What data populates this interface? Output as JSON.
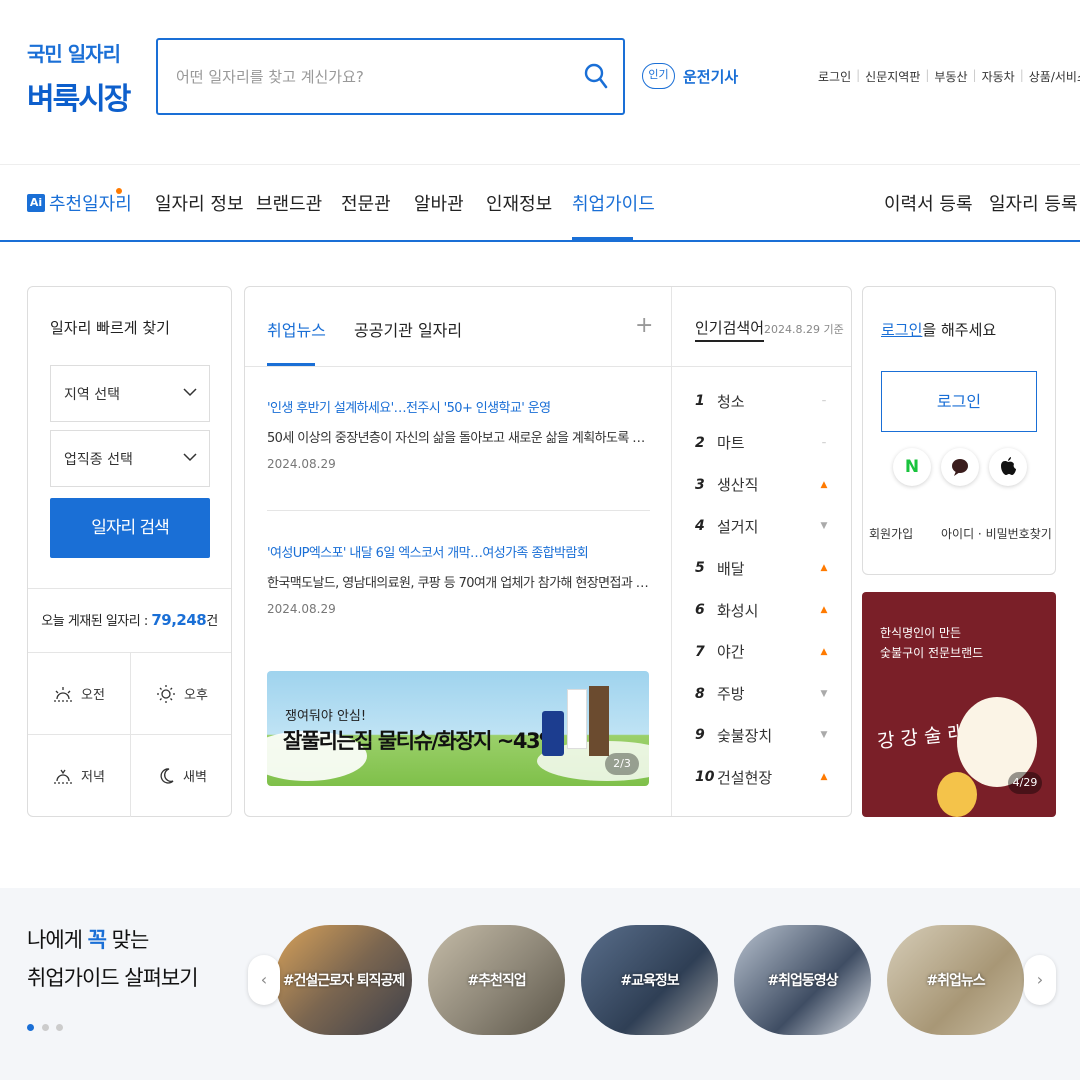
{
  "brand": {
    "line1": "국민 일자리",
    "line2": "벼룩시장"
  },
  "search": {
    "placeholder": "어떤 일자리를 찾고 계신가요?",
    "popular_badge": "인기",
    "popular_keyword": "운전기사"
  },
  "top_links": [
    "로그인",
    "신문지역판",
    "부동산",
    "자동차",
    "상품/서비스"
  ],
  "nav": {
    "ai_badge": "Ai",
    "items": [
      "추천일자리",
      "일자리 정보",
      "브랜드관",
      "전문관",
      "알바관",
      "인재정보",
      "취업가이드"
    ],
    "right": [
      "이력서 등록",
      "일자리 등록"
    ],
    "active": "취업가이드"
  },
  "quick_find": {
    "title": "일자리 빠르게 찾기",
    "region": "지역 선택",
    "category": "업직종 선택",
    "button": "일자리 검색",
    "today_prefix": "오늘 게재된 일자리 : ",
    "today_count": "79,248",
    "today_suffix": "건",
    "times": [
      "오전",
      "오후",
      "저녁",
      "새벽"
    ]
  },
  "news": {
    "tabs": [
      "취업뉴스",
      "공공기관 일자리"
    ],
    "more": "+",
    "items": [
      {
        "title": "'인생 후반기 설계하세요'…전주시 '50+ 인생학교' 운영",
        "desc": "50세 이상의 중장년층이 자신의 삶을 돌아보고 새로운 삶을 계획하도록 돕는 ...",
        "date": "2024.08.29"
      },
      {
        "title": "'여성UP엑스포' 내달 6일 엑스코서 개막…여성가족 종합박람회",
        "desc": "한국맥도날드, 영남대의료원, 쿠팡 등 70여개 업체가 참가해 현장면접과 취창...",
        "date": "2024.08.29"
      }
    ],
    "banner": {
      "line1": "쟁여둬야 안심!",
      "line2": "잘풀리는집 물티슈/화장지 ~43%",
      "pager": "2/3"
    }
  },
  "ranking": {
    "title": "인기검색어",
    "date": "2024.8.29 기준",
    "items": [
      {
        "rank": "1",
        "keyword": "청소",
        "trend": "same"
      },
      {
        "rank": "2",
        "keyword": "마트",
        "trend": "same"
      },
      {
        "rank": "3",
        "keyword": "생산직",
        "trend": "up"
      },
      {
        "rank": "4",
        "keyword": "설거지",
        "trend": "down"
      },
      {
        "rank": "5",
        "keyword": "배달",
        "trend": "up"
      },
      {
        "rank": "6",
        "keyword": "화성시",
        "trend": "up"
      },
      {
        "rank": "7",
        "keyword": "야간",
        "trend": "up"
      },
      {
        "rank": "8",
        "keyword": "주방",
        "trend": "down"
      },
      {
        "rank": "9",
        "keyword": "숯불장치",
        "trend": "down"
      },
      {
        "rank": "10",
        "keyword": "건설현장",
        "trend": "up"
      }
    ]
  },
  "login": {
    "prompt_link": "로그인",
    "prompt_rest": "을 해주세요",
    "button": "로그인",
    "social": [
      "naver-icon",
      "kakao-icon",
      "apple-icon"
    ],
    "naver_letter": "N",
    "signup": "회원가입",
    "find": "아이디 · 비밀번호찾기"
  },
  "ad": {
    "line1": "한식명인이 만든",
    "line2": "숯불구이 전문브랜드",
    "brand_text": "강강술래",
    "pager": "4/29"
  },
  "guide": {
    "title_1": "나에게 ",
    "title_highlight": "꼭",
    "title_2": " 맞는",
    "title_line2": "취업가이드 살펴보기",
    "cards": [
      "#건설근로자 퇴직공제",
      "#추천직업",
      "#교육정보",
      "#취업동영상",
      "#취업뉴스"
    ],
    "prev": "‹",
    "next": "›"
  },
  "colors": {
    "accent": "#1a6fd6",
    "up": "#ff7a00",
    "ad_bg": "#7a1f28"
  }
}
